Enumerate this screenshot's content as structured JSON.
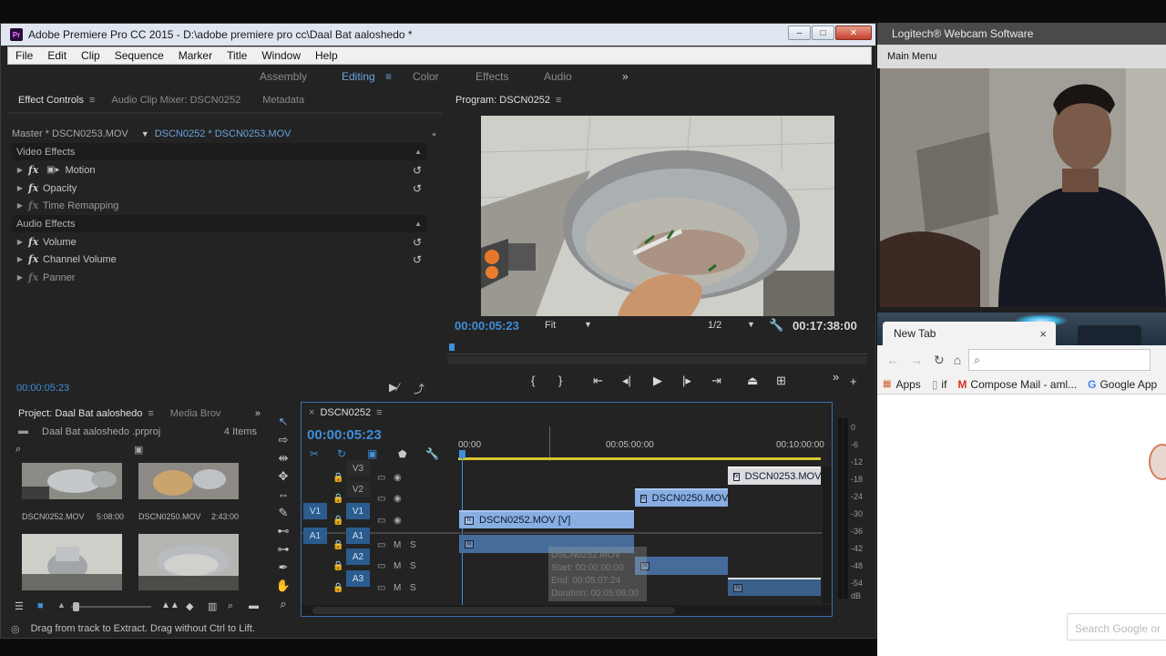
{
  "premiere": {
    "title": "Adobe Premiere Pro CC 2015 - D:\\adobe premiere pro cc\\Daal Bat aaloshedo *",
    "logo": "Pr",
    "window_buttons": {
      "minimize": "–",
      "maximize": "□",
      "close": "✕"
    },
    "menu": [
      "File",
      "Edit",
      "Clip",
      "Sequence",
      "Marker",
      "Title",
      "Window",
      "Help"
    ],
    "workspaces": [
      "Assembly",
      "Editing",
      "Color",
      "Effects",
      "Audio"
    ],
    "workspace_active": "Editing",
    "workspace_more": "»",
    "effect_controls": {
      "tabs": [
        "Effect Controls",
        "Audio Clip Mixer: DSCN0252",
        "Metadata"
      ],
      "master_label": "Master * DSCN0253.MOV",
      "clip_label": "DSCN0252 * DSCN0253.MOV",
      "video_effects_header": "Video Effects",
      "video_effects": [
        "Motion",
        "Opacity",
        "Time Remapping"
      ],
      "audio_effects_header": "Audio Effects",
      "audio_effects": [
        "Volume",
        "Channel Volume",
        "Panner"
      ],
      "fx_symbol": "fx",
      "timecode": "00:00:05:23"
    },
    "program_monitor": {
      "tab": "Program: DSCN0252",
      "timecode": "00:00:05:23",
      "fit": "Fit",
      "resolution": "1/2",
      "duration": "00:17:38:00"
    },
    "project": {
      "tabs": [
        "Project: Daal Bat aaloshedo",
        "Media Brov"
      ],
      "project_file": "Daal Bat aaloshedo .prproj",
      "item_count": "4 Items",
      "clips": [
        {
          "name": "DSCN0252.MOV",
          "duration": "5:08:00"
        },
        {
          "name": "DSCN0250.MOV",
          "duration": "2:43:00"
        }
      ]
    },
    "timeline": {
      "tab": "DSCN0252",
      "close_glyph": "×",
      "timecode": "00:00:05:23",
      "ruler": [
        "00:00",
        "00:05:00:00",
        "00:10:00:00"
      ],
      "tracks_video": [
        "V3",
        "V2",
        "V1"
      ],
      "tracks_audio": [
        "A1",
        "A2",
        "A3"
      ],
      "source_v": "V1",
      "source_a": "A1",
      "clips": {
        "v3": "DSCN0253.MOV",
        "v2": "DSCN0250.MOV",
        "v1": "DSCN0252.MOV [V]"
      },
      "tooltip": {
        "name": "DSCN0252.MOV",
        "start": "Start: 00:00:00:00",
        "end": "End: 00:05:07:24",
        "duration": "Duration: 00:05:08:00"
      }
    },
    "meter_db": [
      "0",
      "-6",
      "-12",
      "-18",
      "-24",
      "-30",
      "-36",
      "-42",
      "-48",
      "-54",
      "dB"
    ],
    "status": "Drag from track to Extract. Drag without Ctrl to Lift."
  },
  "webcam": {
    "title": "Logitech® Webcam Software",
    "menu": "Main Menu"
  },
  "chrome": {
    "tab_title": "New Tab",
    "tab_close": "×",
    "bookmarks": [
      "Apps",
      "if",
      "Compose Mail - aml...",
      "Google App"
    ],
    "search_hint": "Search Google or"
  },
  "colors": {
    "accent_blue": "#3f8ed9",
    "video_clip": "#88aee2",
    "audio_clip": "#456c9a",
    "panel_bg": "#232323"
  }
}
